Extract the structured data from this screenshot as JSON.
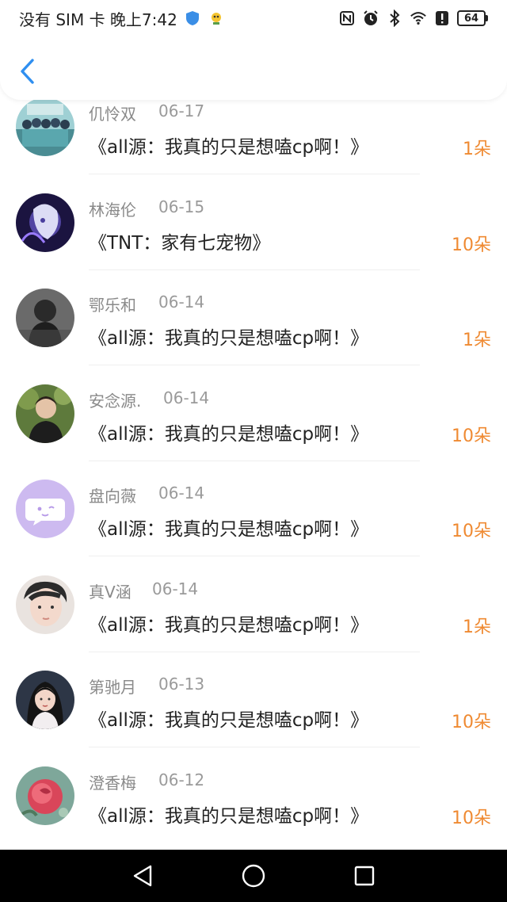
{
  "status_bar": {
    "carrier_time": "没有 SIM 卡 晚上7:42",
    "battery": "64",
    "colors": {
      "shield": "#3a8ee6",
      "text": "#222222"
    }
  },
  "header": {
    "back_icon": "chevron-left-icon",
    "accent": "#2f8ff0"
  },
  "rows": [
    {
      "name": "仉怜双",
      "date": "06-17",
      "title": "《all源：我真的只是想嗑cp啊！》",
      "amount": "1朵",
      "avatar": "group-photo"
    },
    {
      "name": "林海伦",
      "date": "06-15",
      "title": "《TNT：家有七宠物》",
      "amount": "10朵",
      "avatar": "anime-art"
    },
    {
      "name": "鄂乐和",
      "date": "06-14",
      "title": "《all源：我真的只是想嗑cp啊！》",
      "amount": "1朵",
      "avatar": "bw-portrait"
    },
    {
      "name": "安念源.",
      "date": "06-14",
      "title": "《all源：我真的只是想嗑cp啊！》",
      "amount": "10朵",
      "avatar": "boy-photo"
    },
    {
      "name": "盘向薇",
      "date": "06-14",
      "title": "《all源：我真的只是想嗑cp啊！》",
      "amount": "10朵",
      "avatar": "default-chat-avatar"
    },
    {
      "name": "真V涵",
      "date": "06-14",
      "title": "《all源：我真的只是想嗑cp啊！》",
      "amount": "1朵",
      "avatar": "boy-closeup"
    },
    {
      "name": "第驰月",
      "date": "06-13",
      "title": "《all源：我真的只是想嗑cp啊！》",
      "amount": "10朵",
      "avatar": "illustrated-girl"
    },
    {
      "name": "澄香梅",
      "date": "06-12",
      "title": "《all源：我真的只是想嗑cp啊！》",
      "amount": "10朵",
      "avatar": "rose-photo"
    }
  ],
  "colors": {
    "amount": "#ef8a32",
    "name": "#8a8a8a",
    "title": "#222222"
  },
  "nav": {
    "back": "triangle-back-icon",
    "home": "circle-home-icon",
    "recents": "square-recents-icon"
  }
}
